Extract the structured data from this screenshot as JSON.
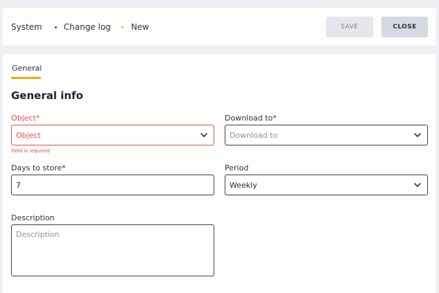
{
  "breadcrumb": [
    "System",
    "Change log",
    "New"
  ],
  "buttons": {
    "save": "SAVE",
    "close": "CLOSE"
  },
  "tabs": [
    {
      "label": "General",
      "active": true
    }
  ],
  "section_title": "General info",
  "form": {
    "object": {
      "label": "Object*",
      "placeholder": "Object",
      "value": "",
      "error": "Field is required"
    },
    "download_to": {
      "label": "Download to*",
      "placeholder": "Download to",
      "value": ""
    },
    "days_to_store": {
      "label": "Days to store*",
      "value": "7"
    },
    "period": {
      "label": "Period",
      "value": "Weekly"
    },
    "description": {
      "label": "Description",
      "placeholder": "Description",
      "value": ""
    }
  },
  "colors": {
    "accent": "#f0b000",
    "error": "#d9534f",
    "border": "#3a3f52"
  },
  "icons": {
    "select": "chevron-down-icon"
  }
}
